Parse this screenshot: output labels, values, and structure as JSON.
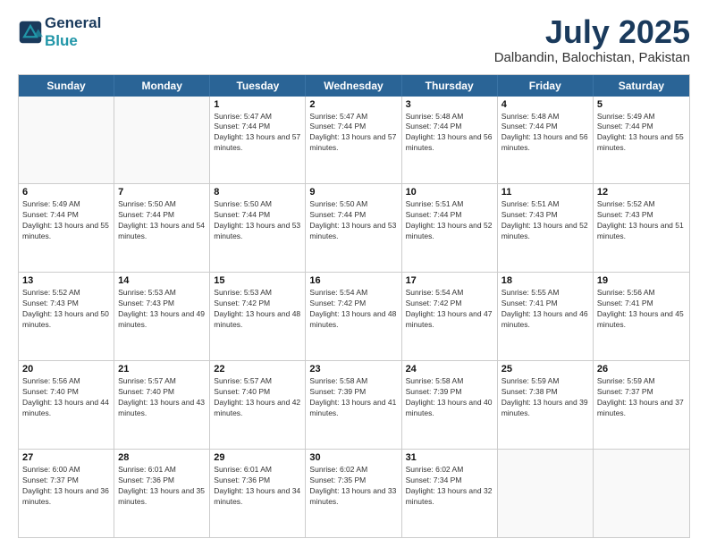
{
  "header": {
    "logo_line1": "General",
    "logo_line2": "Blue",
    "main_title": "July 2025",
    "subtitle": "Dalbandin, Balochistan, Pakistan"
  },
  "calendar": {
    "days_of_week": [
      "Sunday",
      "Monday",
      "Tuesday",
      "Wednesday",
      "Thursday",
      "Friday",
      "Saturday"
    ],
    "weeks": [
      [
        {
          "day": "",
          "sunrise": "",
          "sunset": "",
          "daylight": ""
        },
        {
          "day": "",
          "sunrise": "",
          "sunset": "",
          "daylight": ""
        },
        {
          "day": "1",
          "sunrise": "Sunrise: 5:47 AM",
          "sunset": "Sunset: 7:44 PM",
          "daylight": "Daylight: 13 hours and 57 minutes."
        },
        {
          "day": "2",
          "sunrise": "Sunrise: 5:47 AM",
          "sunset": "Sunset: 7:44 PM",
          "daylight": "Daylight: 13 hours and 57 minutes."
        },
        {
          "day": "3",
          "sunrise": "Sunrise: 5:48 AM",
          "sunset": "Sunset: 7:44 PM",
          "daylight": "Daylight: 13 hours and 56 minutes."
        },
        {
          "day": "4",
          "sunrise": "Sunrise: 5:48 AM",
          "sunset": "Sunset: 7:44 PM",
          "daylight": "Daylight: 13 hours and 56 minutes."
        },
        {
          "day": "5",
          "sunrise": "Sunrise: 5:49 AM",
          "sunset": "Sunset: 7:44 PM",
          "daylight": "Daylight: 13 hours and 55 minutes."
        }
      ],
      [
        {
          "day": "6",
          "sunrise": "Sunrise: 5:49 AM",
          "sunset": "Sunset: 7:44 PM",
          "daylight": "Daylight: 13 hours and 55 minutes."
        },
        {
          "day": "7",
          "sunrise": "Sunrise: 5:50 AM",
          "sunset": "Sunset: 7:44 PM",
          "daylight": "Daylight: 13 hours and 54 minutes."
        },
        {
          "day": "8",
          "sunrise": "Sunrise: 5:50 AM",
          "sunset": "Sunset: 7:44 PM",
          "daylight": "Daylight: 13 hours and 53 minutes."
        },
        {
          "day": "9",
          "sunrise": "Sunrise: 5:50 AM",
          "sunset": "Sunset: 7:44 PM",
          "daylight": "Daylight: 13 hours and 53 minutes."
        },
        {
          "day": "10",
          "sunrise": "Sunrise: 5:51 AM",
          "sunset": "Sunset: 7:44 PM",
          "daylight": "Daylight: 13 hours and 52 minutes."
        },
        {
          "day": "11",
          "sunrise": "Sunrise: 5:51 AM",
          "sunset": "Sunset: 7:43 PM",
          "daylight": "Daylight: 13 hours and 52 minutes."
        },
        {
          "day": "12",
          "sunrise": "Sunrise: 5:52 AM",
          "sunset": "Sunset: 7:43 PM",
          "daylight": "Daylight: 13 hours and 51 minutes."
        }
      ],
      [
        {
          "day": "13",
          "sunrise": "Sunrise: 5:52 AM",
          "sunset": "Sunset: 7:43 PM",
          "daylight": "Daylight: 13 hours and 50 minutes."
        },
        {
          "day": "14",
          "sunrise": "Sunrise: 5:53 AM",
          "sunset": "Sunset: 7:43 PM",
          "daylight": "Daylight: 13 hours and 49 minutes."
        },
        {
          "day": "15",
          "sunrise": "Sunrise: 5:53 AM",
          "sunset": "Sunset: 7:42 PM",
          "daylight": "Daylight: 13 hours and 48 minutes."
        },
        {
          "day": "16",
          "sunrise": "Sunrise: 5:54 AM",
          "sunset": "Sunset: 7:42 PM",
          "daylight": "Daylight: 13 hours and 48 minutes."
        },
        {
          "day": "17",
          "sunrise": "Sunrise: 5:54 AM",
          "sunset": "Sunset: 7:42 PM",
          "daylight": "Daylight: 13 hours and 47 minutes."
        },
        {
          "day": "18",
          "sunrise": "Sunrise: 5:55 AM",
          "sunset": "Sunset: 7:41 PM",
          "daylight": "Daylight: 13 hours and 46 minutes."
        },
        {
          "day": "19",
          "sunrise": "Sunrise: 5:56 AM",
          "sunset": "Sunset: 7:41 PM",
          "daylight": "Daylight: 13 hours and 45 minutes."
        }
      ],
      [
        {
          "day": "20",
          "sunrise": "Sunrise: 5:56 AM",
          "sunset": "Sunset: 7:40 PM",
          "daylight": "Daylight: 13 hours and 44 minutes."
        },
        {
          "day": "21",
          "sunrise": "Sunrise: 5:57 AM",
          "sunset": "Sunset: 7:40 PM",
          "daylight": "Daylight: 13 hours and 43 minutes."
        },
        {
          "day": "22",
          "sunrise": "Sunrise: 5:57 AM",
          "sunset": "Sunset: 7:40 PM",
          "daylight": "Daylight: 13 hours and 42 minutes."
        },
        {
          "day": "23",
          "sunrise": "Sunrise: 5:58 AM",
          "sunset": "Sunset: 7:39 PM",
          "daylight": "Daylight: 13 hours and 41 minutes."
        },
        {
          "day": "24",
          "sunrise": "Sunrise: 5:58 AM",
          "sunset": "Sunset: 7:39 PM",
          "daylight": "Daylight: 13 hours and 40 minutes."
        },
        {
          "day": "25",
          "sunrise": "Sunrise: 5:59 AM",
          "sunset": "Sunset: 7:38 PM",
          "daylight": "Daylight: 13 hours and 39 minutes."
        },
        {
          "day": "26",
          "sunrise": "Sunrise: 5:59 AM",
          "sunset": "Sunset: 7:37 PM",
          "daylight": "Daylight: 13 hours and 37 minutes."
        }
      ],
      [
        {
          "day": "27",
          "sunrise": "Sunrise: 6:00 AM",
          "sunset": "Sunset: 7:37 PM",
          "daylight": "Daylight: 13 hours and 36 minutes."
        },
        {
          "day": "28",
          "sunrise": "Sunrise: 6:01 AM",
          "sunset": "Sunset: 7:36 PM",
          "daylight": "Daylight: 13 hours and 35 minutes."
        },
        {
          "day": "29",
          "sunrise": "Sunrise: 6:01 AM",
          "sunset": "Sunset: 7:36 PM",
          "daylight": "Daylight: 13 hours and 34 minutes."
        },
        {
          "day": "30",
          "sunrise": "Sunrise: 6:02 AM",
          "sunset": "Sunset: 7:35 PM",
          "daylight": "Daylight: 13 hours and 33 minutes."
        },
        {
          "day": "31",
          "sunrise": "Sunrise: 6:02 AM",
          "sunset": "Sunset: 7:34 PM",
          "daylight": "Daylight: 13 hours and 32 minutes."
        },
        {
          "day": "",
          "sunrise": "",
          "sunset": "",
          "daylight": ""
        },
        {
          "day": "",
          "sunrise": "",
          "sunset": "",
          "daylight": ""
        }
      ]
    ]
  }
}
